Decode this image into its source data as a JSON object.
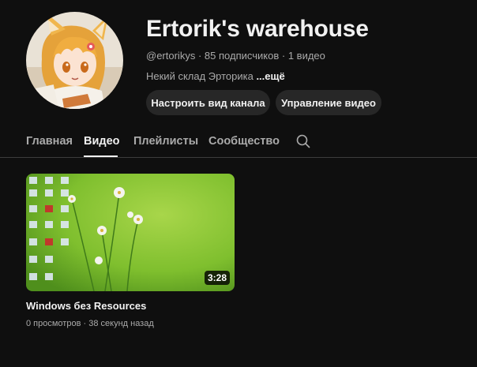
{
  "channel": {
    "title": "Ertorik's warehouse",
    "handle": "@ertorikys",
    "subscribers": "85 подписчиков",
    "video_count": "1 видео",
    "description": "Некий склад Эрторика",
    "more_label": "...ещё",
    "avatar_icon": "anime-fox-girl-avatar"
  },
  "buttons": {
    "customize": "Настроить вид канала",
    "manage": "Управление видео"
  },
  "tabs": [
    {
      "label": "Главная"
    },
    {
      "label": "Видео"
    },
    {
      "label": "Плейлисты"
    },
    {
      "label": "Сообщество"
    }
  ],
  "active_tab": "Видео",
  "search_icon": "search-icon",
  "videos": [
    {
      "title": "Windows без Resources",
      "views": "0 просмотров",
      "age": "38 секунд назад",
      "duration": "3:28"
    }
  ],
  "colors": {
    "background": "#0f0f0f",
    "button": "#272727",
    "secondary_text": "#aaaaaa"
  }
}
